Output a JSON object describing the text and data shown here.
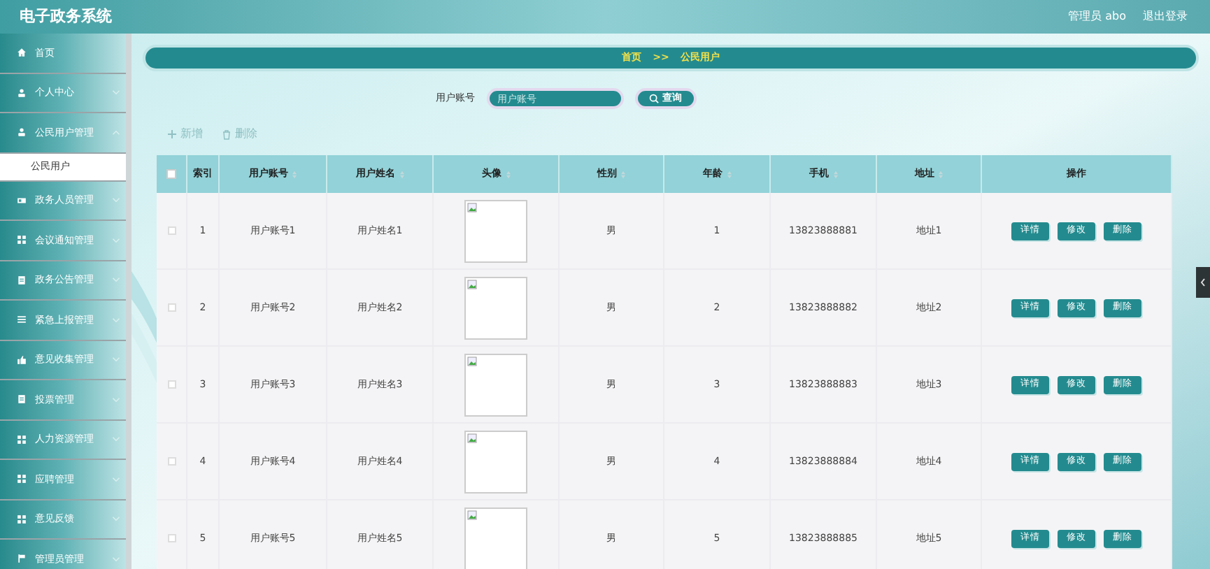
{
  "header": {
    "title": "电子政务系统",
    "user": "管理员 abo",
    "logout": "退出登录"
  },
  "sidebar": {
    "items": [
      {
        "kind": "link",
        "label": "首页",
        "selected": false
      },
      {
        "kind": "group",
        "label": "个人中心",
        "expanded": false,
        "selected": false
      },
      {
        "kind": "group",
        "label": "公民用户管理",
        "expanded": true,
        "selected": false,
        "children": [
          {
            "label": "公民用户",
            "selected": true
          }
        ]
      },
      {
        "kind": "group",
        "label": "政务人员管理",
        "expanded": false,
        "selected": false
      },
      {
        "kind": "group",
        "label": "会议通知管理",
        "expanded": false,
        "selected": false
      },
      {
        "kind": "group",
        "label": "政务公告管理",
        "expanded": false,
        "selected": false
      },
      {
        "kind": "group",
        "label": "紧急上报管理",
        "expanded": false,
        "selected": false
      },
      {
        "kind": "group",
        "label": "意见收集管理",
        "expanded": false,
        "selected": false
      },
      {
        "kind": "group",
        "label": "投票管理",
        "expanded": false,
        "selected": false
      },
      {
        "kind": "group",
        "label": "人力资源管理",
        "expanded": false,
        "selected": false
      },
      {
        "kind": "group",
        "label": "应聘管理",
        "expanded": false,
        "selected": false
      },
      {
        "kind": "group",
        "label": "意见反馈",
        "expanded": false,
        "selected": false
      },
      {
        "kind": "group",
        "label": "管理员管理",
        "expanded": false,
        "selected": false
      }
    ]
  },
  "breadcrumb": {
    "items": [
      "首页",
      "公民用户"
    ],
    "separator": ">>"
  },
  "search": {
    "label": "用户账号",
    "placeholder": "用户账号",
    "button": "查询"
  },
  "toolbar": {
    "add": "新增",
    "delete": "删除"
  },
  "table": {
    "select_all": {
      "checked": false
    },
    "columns": [
      {
        "label": "索引",
        "sortable": false
      },
      {
        "label": "用户账号",
        "sortable": true
      },
      {
        "label": "用户姓名",
        "sortable": true
      },
      {
        "label": "头像",
        "sortable": true
      },
      {
        "label": "性别",
        "sortable": true
      },
      {
        "label": "年龄",
        "sortable": true
      },
      {
        "label": "手机",
        "sortable": true
      },
      {
        "label": "地址",
        "sortable": true
      },
      {
        "label": "操作",
        "sortable": false
      }
    ],
    "rows": [
      {
        "checked": false,
        "cells": [
          "1",
          "用户账号1",
          "用户姓名1",
          {
            "kind": "broken_image"
          },
          "男",
          "1",
          "13823888881",
          "地址1"
        ],
        "actions": [
          "详情",
          "修改",
          "删除"
        ]
      },
      {
        "checked": false,
        "cells": [
          "2",
          "用户账号2",
          "用户姓名2",
          {
            "kind": "broken_image"
          },
          "男",
          "2",
          "13823888882",
          "地址2"
        ],
        "actions": [
          "详情",
          "修改",
          "删除"
        ]
      },
      {
        "checked": false,
        "cells": [
          "3",
          "用户账号3",
          "用户姓名3",
          {
            "kind": "broken_image"
          },
          "男",
          "3",
          "13823888883",
          "地址3"
        ],
        "actions": [
          "详情",
          "修改",
          "删除"
        ]
      },
      {
        "checked": false,
        "cells": [
          "4",
          "用户账号4",
          "用户姓名4",
          {
            "kind": "broken_image"
          },
          "男",
          "4",
          "13823888884",
          "地址4"
        ],
        "actions": [
          "详情",
          "修改",
          "删除"
        ]
      },
      {
        "checked": false,
        "cells": [
          "5",
          "用户账号5",
          "用户姓名5",
          {
            "kind": "broken_image"
          },
          "男",
          "5",
          "13823888885",
          "地址5"
        ],
        "actions": [
          "详情",
          "修改",
          "删除"
        ]
      }
    ]
  }
}
